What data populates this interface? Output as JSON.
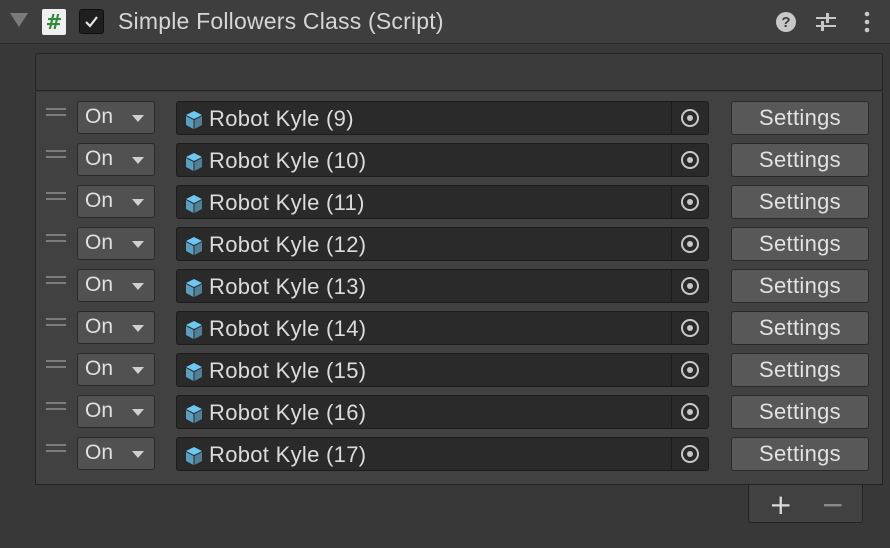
{
  "component": {
    "title": "Simple Followers Class (Script)",
    "enabled": true,
    "script_icon_symbol": "#",
    "icons": {
      "foldout": "foldout-expanded-icon",
      "script": "csharp-script-icon",
      "help": "help-icon",
      "presets": "preset-sliders-icon",
      "menu": "kebab-menu-icon"
    }
  },
  "list": {
    "rows": [
      {
        "state": "On",
        "object": "Robot Kyle (9)",
        "button": "Settings"
      },
      {
        "state": "On",
        "object": "Robot Kyle (10)",
        "button": "Settings"
      },
      {
        "state": "On",
        "object": "Robot Kyle (11)",
        "button": "Settings"
      },
      {
        "state": "On",
        "object": "Robot Kyle (12)",
        "button": "Settings"
      },
      {
        "state": "On",
        "object": "Robot Kyle (13)",
        "button": "Settings"
      },
      {
        "state": "On",
        "object": "Robot Kyle (14)",
        "button": "Settings"
      },
      {
        "state": "On",
        "object": "Robot Kyle (15)",
        "button": "Settings"
      },
      {
        "state": "On",
        "object": "Robot Kyle (16)",
        "button": "Settings"
      },
      {
        "state": "On",
        "object": "Robot Kyle (17)",
        "button": "Settings"
      }
    ],
    "add_label": "+",
    "remove_label": "−"
  },
  "colors": {
    "background": "#383838",
    "field": "#2a2a2a",
    "button": "#585858",
    "cube_icon": "#6ec6f2"
  }
}
